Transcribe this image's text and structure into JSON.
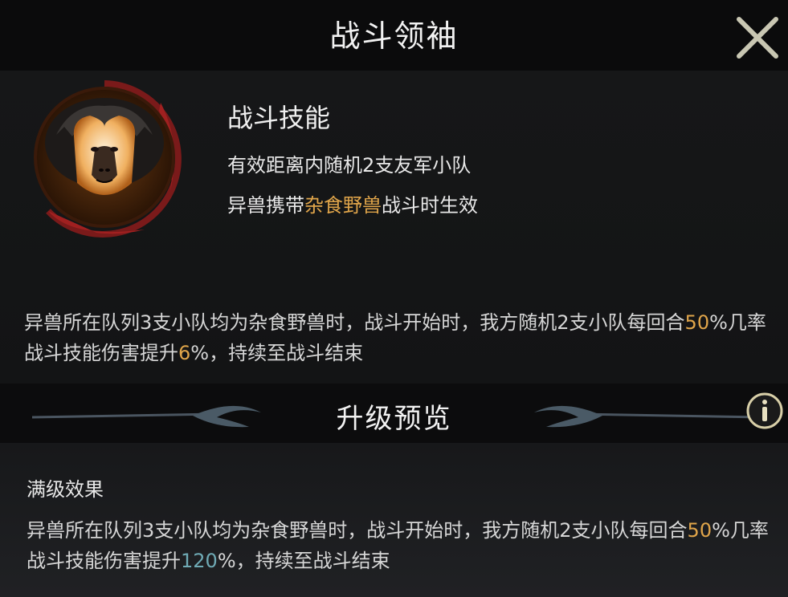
{
  "header": {
    "title": "战斗领袖",
    "close_icon": "close-x-icon"
  },
  "skill": {
    "portrait_icon": "monkey-portrait-icon",
    "title": "战斗技能",
    "line1": "有效距离内随机2支友军小队",
    "line2_prefix": "异兽携带",
    "line2_highlight": "杂食野兽",
    "line2_suffix": "战斗时生效"
  },
  "current_effect": {
    "part1": "异兽所在队列3支小队均为杂食野兽时，战斗开始时，我方随机2支小队每回合",
    "chance": "50",
    "part2": "%几率战斗技能伤害提升",
    "boost": "6",
    "part3": "%，持续至战斗结束"
  },
  "upgrade": {
    "title": "升级预览",
    "info_icon": "info-icon"
  },
  "max_level": {
    "label": "满级效果",
    "part1": "异兽所在队列3支小队均为杂食野兽时，战斗开始时，我方随机2支小队每回合",
    "chance": "50",
    "part2": "%几率战斗技能伤害提升",
    "boost": "120",
    "part3": "%，持续至战斗结束"
  },
  "colors": {
    "gold": "#e0a54a",
    "teal": "#6faab5",
    "portrait_ring": "#8a1e1e"
  }
}
